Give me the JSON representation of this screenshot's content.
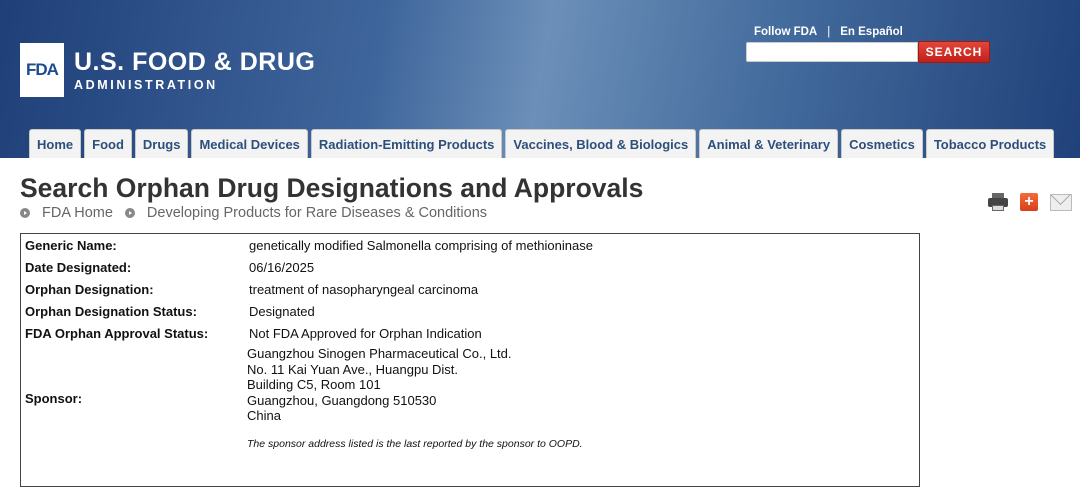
{
  "header": {
    "logo_mark": "FDA",
    "logo_title": "U.S. FOOD & DRUG",
    "logo_subtitle": "ADMINISTRATION",
    "follow_link": "Follow FDA",
    "separator": "|",
    "spanish_link": "En Español",
    "search_button": "SEARCH",
    "search_value": ""
  },
  "nav": {
    "tabs": [
      {
        "label": "Home"
      },
      {
        "label": "Food"
      },
      {
        "label": "Drugs"
      },
      {
        "label": "Medical Devices"
      },
      {
        "label": "Radiation-Emitting Products"
      },
      {
        "label": "Vaccines, Blood & Biologics"
      },
      {
        "label": "Animal & Veterinary"
      },
      {
        "label": "Cosmetics"
      },
      {
        "label": "Tobacco Products"
      }
    ]
  },
  "page": {
    "title": "Search Orphan Drug Designations and Approvals",
    "breadcrumb": [
      "FDA Home",
      "Developing Products for Rare Diseases & Conditions"
    ]
  },
  "tools": [
    "print-icon",
    "share-plus-icon",
    "email-icon"
  ],
  "details": {
    "generic_name_label": "Generic Name:",
    "generic_name": "genetically modified Salmonella comprising of methioninase",
    "date_label": "Date Designated:",
    "date": "06/16/2025",
    "designation_label": "Orphan Designation:",
    "designation": "treatment of nasopharyngeal carcinoma",
    "status_label": "Orphan Designation Status:",
    "status": "Designated",
    "approval_label": "FDA Orphan Approval Status:",
    "approval": "Not FDA Approved for Orphan Indication",
    "sponsor_label": "Sponsor:",
    "sponsor_lines": [
      "Guangzhou Sinogen Pharmaceutical Co., Ltd.",
      "No. 11 Kai Yuan Ave., Huangpu Dist.",
      "Building C5, Room 101",
      "Guangzhou, Guangdong 510530",
      "China"
    ],
    "sponsor_note": "The sponsor address listed is the last reported by the sponsor to OOPD."
  }
}
